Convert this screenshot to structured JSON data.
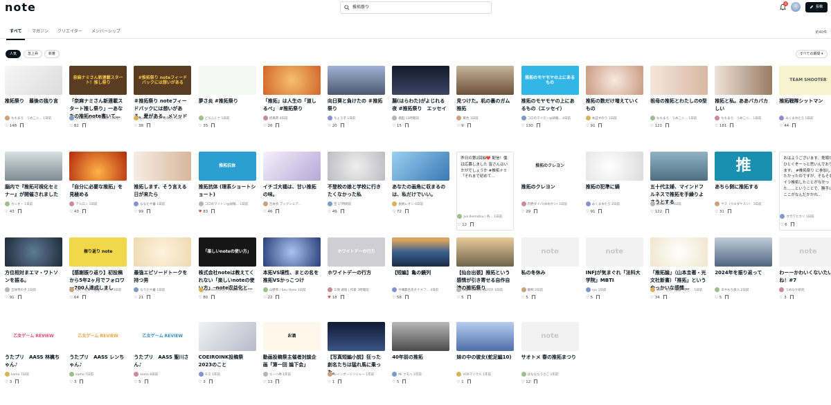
{
  "header": {
    "logo": "note",
    "search_value": "推拓祭り",
    "notification_count": "8",
    "post_label": "投稿"
  },
  "tabs": [
    {
      "label": "すべて",
      "active": true
    },
    {
      "label": "マガジン"
    },
    {
      "label": "クリエイター"
    },
    {
      "label": "メンバーシップ"
    }
  ],
  "result_count": "約40件",
  "sort": {
    "pills": [
      {
        "label": "人気",
        "active": true
      },
      {
        "label": "急上昇"
      },
      {
        "label": "新着"
      }
    ],
    "period": "すべての期間 ▾"
  },
  "rows": [
    [
      {
        "img": "photo-ghost",
        "bg": "#eeeeee",
        "title": "推拓祭り　最後の独り言",
        "author": "ももまろ　うめこニ...",
        "time": "1日前",
        "likes": "148"
      },
      {
        "img": "banner-nami",
        "bg": "#5a3c22",
        "fg": "#f7ca47",
        "thumb_text": "奈麻ナミさん新連載スタート！推し祭り",
        "title": "「奈麻ナミさん新連載スタート推し祭り」一あなたの推拓note書いて…",
        "author": "Jun Ikematsu / 各和則",
        "time": "11日前",
        "likes": "82"
      },
      {
        "img": "banner-feedback",
        "bg": "#5a3c22",
        "fg": "#f7ca47",
        "thumb_text": "#推拓祭り noteフィードバックには想いがある",
        "title": "＃推拓祭り noteフィードバックには想いがある。愛がある。メソッドがある。",
        "author": "Jun Ikematsu / 各和則",
        "time": "7日前",
        "likes": "38"
      },
      {
        "img": "dreamy-flowers",
        "bg": "#f6f8f5",
        "title": "夢さ炎 #推拓祭り",
        "author": "どらふくナ",
        "time": "1日前",
        "likes": "35"
      },
      {
        "img": "fire-slice",
        "bg": "#e9a04a",
        "title": "「推拓」は人生の「道しるべ」 #推拓祭り",
        "author": "初風荷",
        "time": "4日前",
        "likes": "26"
      },
      {
        "img": "sunflower",
        "bg": "#8a9fc2",
        "title": "向日葵と負けたの ＃推拓祭り",
        "author": "ちょろ子",
        "time": "1日前",
        "likes": "20"
      },
      {
        "img": "night-city",
        "bg": "#1f2535",
        "title": "腸(はらわた)がよじれる夜 #推拓祭り　エッセイ",
        "author": "楢田",
        "time": "11時間前",
        "likes": "15"
      },
      {
        "img": "classroom",
        "bg": "#8c7358",
        "title": "見つけた。机の裏のガム推拓",
        "author": "黄色",
        "time": "1日前",
        "likes": "9"
      },
      {
        "img": "moyamoya",
        "bg": "#32b6e6",
        "fg": "#ffffff",
        "thumb_text": "推拓のモヤモヤの上にあるもの",
        "title": "推拓のモヤモヤの上にあるもの（エッセイ）",
        "author": "コロのマイスン@研報...",
        "time": "4日前",
        "likes": "130"
      },
      {
        "img": "chocolates",
        "bg": "#f5ddd0",
        "title": "推拓の数だけ増えていくもの",
        "author": "本証すのう",
        "time": "1日前",
        "likes": "91"
      },
      {
        "img": "girl-blonde",
        "bg": "#f1ddd1",
        "title": "祖母の推拓とわたしの0型",
        "author": "ももまろ　うめこニ...",
        "time": "1日前",
        "likes": "121"
      },
      {
        "img": "girl-hair",
        "bg": "#cdb9a6",
        "title": "推拓と私。ああバカバカしい",
        "author": "ももまろ　うめこニ...",
        "time": "1日前",
        "likes": "181"
      },
      {
        "img": "cartoon",
        "bg": "#f8f3cf",
        "fg": "#555",
        "thumb_text": "TEAM SHOOTER",
        "title": "推拓戦隊シットマン",
        "author": "みくまゆたろ",
        "time": "1日前",
        "likes": "44"
      }
    ],
    [
      {
        "img": "office",
        "bg": "#a8b4b8",
        "title": "脳内で『推拓可視化セミナー』が開催されました",
        "author": "カシオ・",
        "time": "1日前",
        "likes": "43"
      },
      {
        "img": "flames",
        "bg": "#d9541f",
        "title": "「自分に必要な推拓」を見極める",
        "author": "アルロン",
        "time": "1日前",
        "likes": "43"
      },
      {
        "img": "anime-girl",
        "bg": "#efe3d4",
        "title": "推拓します、そう言える日が来たら",
        "author": "ななたや暮",
        "time": "1日前",
        "likes": "99"
      },
      {
        "img": "banner-short",
        "bg": "#2a9fd0",
        "fg": "#ffffff",
        "thumb_text": "推拓抗体",
        "title": "推拓抗体 (理系ショートショート)",
        "author": "コロのマイトン@研報...",
        "time": "1日前",
        "likes": "83",
        "liked": true
      },
      {
        "img": "purple-wing",
        "bg": "#eaeaf3",
        "title": "イチゴ大福は、甘い推拓の味。",
        "author": "吉本歩",
        "time": "ブックシェア...",
        "likes": "46"
      },
      {
        "img": "heart-cup",
        "bg": "#d8d8da",
        "title": "不登校の娘と学校に行きたくなかった私",
        "author": "空",
        "time": "17時間前",
        "likes": "49"
      },
      {
        "img": "phone-hand",
        "bg": "#6fb1de",
        "title": "あなたの画角に収まるのは、私だけでいい。",
        "author": "長柄レオン",
        "time": "6日前",
        "likes": "72"
      },
      {
        "text_card": true,
        "body": "昨日の第2回抽❤️ 配信！僕は応募しました 皆さんはいかがでしょうか #推拓ナミ「それまで初めて…",
        "author": "Jun Ikematsu / 各...",
        "time": "1日前",
        "likes": "12"
      },
      {
        "img": "kureyon",
        "bg": "#ffffff",
        "fg": "#333",
        "thumb_text": "推拓のクレヨン",
        "title": "推拓のクレヨン",
        "author": "内野ダイバ(ゆめかシ)",
        "time": "1日前",
        "likes": "29"
      },
      {
        "img": "dots-art",
        "bg": "#f4f4f4",
        "title": "推拓の犯準に嫡",
        "author": "みくまゆたろ",
        "time": "2日前",
        "likes": "91"
      },
      {
        "img": "water-rock",
        "bg": "#6c8fa0",
        "title": "五十代主婦、マインドフルネスで推拓を手繰りよさうとする",
        "author": "浮嶋みらい",
        "time": "1日前",
        "likes": "122"
      },
      {
        "img": "fox-banner",
        "bg": "#1b8fb0",
        "fg": "#ffffff",
        "thumb_text": "推",
        "title": "あちら側に推拓する",
        "author": "ヤス（ウエダヤスシ）",
        "time": "1日前",
        "likes": "31"
      },
      {
        "text_card": true,
        "body": "おはようございます。鬼頭がひとぐぞーっと思いんでおります。 #推拓祭り に参加したかったのですが、そもそもイラ推拓したことがなかった……ということで、勝手にここがなんだかかれ…",
        "author": "オガワヒカリ",
        "time": "1日前",
        "likes": "6"
      }
    ],
    [
      {
        "img": "watch",
        "bg": "#3a4a5e",
        "title": "方位相対まエマ・ワトソンを振る。",
        "author": "吉祥寺の子",
        "time": "1日前",
        "likes": "91"
      },
      {
        "img": "furikaeri",
        "bg": "#f1d84a",
        "fg": "#111",
        "thumb_text": "振り返り note",
        "title": "【感謝振り返り】初投稿から5年2ヶ月でフォロワー700人達成しました！…",
        "author": "kon｜考察・推理・レビ...",
        "time": "3日前",
        "likes": "64"
      },
      {
        "img": "peach-arm",
        "bg": "#f7e9cf",
        "title": "最強エピソードトークを持つ男",
        "author": "なりたや暮",
        "time": "1日前",
        "likes": "21"
      },
      {
        "img": "dark-banner",
        "bg": "#161616",
        "fg": "#ffffff",
        "thumb_text": "「楽しいnoteの使い方」",
        "title": "株式会社noteは教えてくれない「楽しいnoteの使い方」─note収益化と…",
        "author": "Jun Ikematsu / 各和則",
        "time": "7日前",
        "likes": "80"
      },
      {
        "img": "blue-vortex",
        "bg": "#4d6cb0",
        "title": "本拓VS墳性、まとの名を推拓VSかっこつけ",
        "author": "山野率 / Sou Hono",
        "time": "1日前",
        "likes": "22"
      },
      {
        "img": "whiteday",
        "bg": "#cfcfd2",
        "fg": "#fff",
        "thumb_text": "ホワイトデーの行方",
        "title": "ホワイトデーの行方",
        "author": "三保 湖恩 | 作家",
        "time": "3時間前",
        "likes": "18",
        "liked": true
      },
      {
        "img": "ocean-sunset",
        "bg": "#2b4870",
        "title": "【短編】亀の鏡列",
        "author": "今禰無名氏チナメフ...",
        "time": "4日前",
        "likes": "58"
      },
      {
        "img": "silhouette",
        "bg": "#a59c7a",
        "title": "【仙台出張】推拓という感情が引き寄せる自作自演の推拓祭り",
        "author": "Light Center NEFER",
        "time": "1日前",
        "likes": "5"
      },
      {
        "img": "note-logo",
        "bg": "#f2f2f2",
        "fg": "#c8c8c8",
        "thumb_text": "note",
        "title": "私の冬休み",
        "author": "飯柳",
        "time": "2日前",
        "likes": "5"
      },
      {
        "img": "note-logo",
        "bg": "#f2f2f2",
        "fg": "#c8c8c8",
        "thumb_text": "note",
        "title": "INFJが気まぐれ「法科大学院」MBTI",
        "author": "ryu",
        "time": "1日前",
        "likes": "5"
      },
      {
        "img": "podium",
        "bg": "#fbf7ed",
        "title": "「推拓論」（山本圭著・光文社新書）「推拓」というやっかいな感情…",
        "author": "kon｜考察・推理・レビ...",
        "time": "5日前",
        "likes": "34"
      },
      {
        "img": "clouds",
        "bg": "#6a7f98",
        "title": "2024年を振り返って",
        "author": "あやもち楽人",
        "time": "2日前",
        "likes": "5"
      },
      {
        "img": "note-logo",
        "bg": "#f2f2f2",
        "fg": "#c8c8c8",
        "thumb_text": "note",
        "title": "わーーかわいくないたいね！#7",
        "author": "うめなか研究",
        "time": "",
        "likes": "3"
      }
    ],
    [
      {
        "img": "aass-1",
        "bg": "#ffffff",
        "fg": "#e4476d",
        "thumb_text": "乙女ゲーム REVIEW",
        "title": "うたプリ　AASS 林檎ちゃん♪",
        "author": "kamo",
        "time": "7日前",
        "likes": "3"
      },
      {
        "img": "aass-2",
        "bg": "#ffffff",
        "fg": "#f4a23a",
        "thumb_text": "乙女ゲーム REVIEW",
        "title": "うたプリ　AASS レンちゃん♪",
        "author": "kamo",
        "time": "7日前",
        "likes": "3"
      },
      {
        "img": "aass-3",
        "bg": "#ffffff",
        "fg": "#2f8fc9",
        "thumb_text": "乙女ゲーム REVIEW",
        "title": "うたプリ　AASS 聖川さん♪",
        "author": "kamo",
        "time": "8日前",
        "likes": "5"
      },
      {
        "img": "anime-boys",
        "bg": "#e6e8ee",
        "title": "COEIROINK投稿祭2023のこと",
        "author": "チス",
        "time": "1年前",
        "likes": "3"
      },
      {
        "img": "osake",
        "bg": "#fff7ea",
        "fg": "#111",
        "thumb_text": "お酒",
        "title": "動画投稿祭主催者対談企画「第一回 論下会」",
        "author": "ユーハ神",
        "time": "1年前",
        "likes": "13"
      },
      {
        "img": "night-bay",
        "bg": "#1a2440",
        "title": "【写真短編小説】狂った創名たちは猛れ馬に乗った。",
        "author": "レインボーシンシャー",
        "time": "1年前",
        "likes": "1"
      },
      {
        "img": "forest-bw",
        "bg": "#7f7f7f",
        "title": "40年前の推拓",
        "author": "Mr.クモハ",
        "time": "1年前",
        "likes": "5"
      },
      {
        "img": "anime-crowd",
        "bg": "#7a9cd0",
        "title": "妹の中の彼女(蛇足編10)",
        "author": "VOXマイケル",
        "time": "1年前",
        "likes": "1"
      },
      {
        "img": "note-logo",
        "bg": "#f2f2f2",
        "fg": "#c8c8c8",
        "thumb_text": "note",
        "title": "サオトメ 春の推拓まつり",
        "author": "ばなななうさこ",
        "time": "1年前",
        "likes": "12"
      }
    ]
  ]
}
